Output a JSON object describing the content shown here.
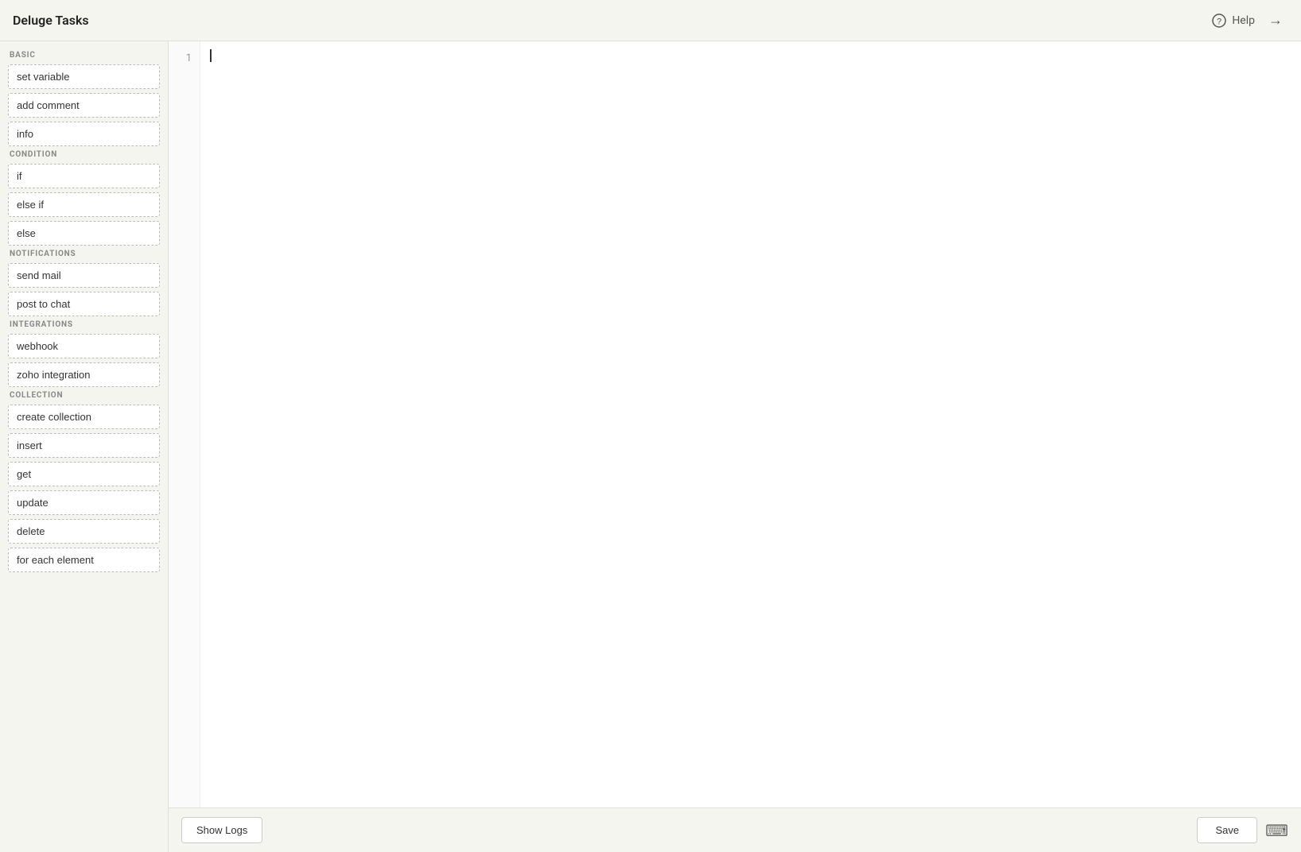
{
  "header": {
    "title": "Deluge Tasks",
    "help_label": "Help"
  },
  "sidebar": {
    "sections": [
      {
        "id": "basic",
        "label": "BASIC",
        "items": [
          {
            "id": "set-variable",
            "label": "set variable"
          },
          {
            "id": "add-comment",
            "label": "add comment"
          },
          {
            "id": "info",
            "label": "info"
          }
        ]
      },
      {
        "id": "condition",
        "label": "CONDITION",
        "items": [
          {
            "id": "if",
            "label": "if"
          },
          {
            "id": "else-if",
            "label": "else if"
          },
          {
            "id": "else",
            "label": "else"
          }
        ]
      },
      {
        "id": "notifications",
        "label": "NOTIFICATIONS",
        "items": [
          {
            "id": "send-mail",
            "label": "send mail"
          },
          {
            "id": "post-to-chat",
            "label": "post to chat"
          }
        ]
      },
      {
        "id": "integrations",
        "label": "INTEGRATIONS",
        "items": [
          {
            "id": "webhook",
            "label": "webhook"
          },
          {
            "id": "zoho-integration",
            "label": "zoho integration"
          }
        ]
      },
      {
        "id": "collection",
        "label": "COLLECTION",
        "items": [
          {
            "id": "create-collection",
            "label": "create collection"
          },
          {
            "id": "insert",
            "label": "insert"
          },
          {
            "id": "get",
            "label": "get"
          },
          {
            "id": "update",
            "label": "update"
          },
          {
            "id": "delete",
            "label": "delete"
          },
          {
            "id": "for-each-element",
            "label": "for each element"
          }
        ]
      }
    ]
  },
  "editor": {
    "line_number": "1"
  },
  "bottom_bar": {
    "show_logs_label": "Show Logs",
    "save_label": "Save"
  },
  "icons": {
    "help": "?",
    "arrow_right": "→",
    "keyboard": "⌨"
  }
}
